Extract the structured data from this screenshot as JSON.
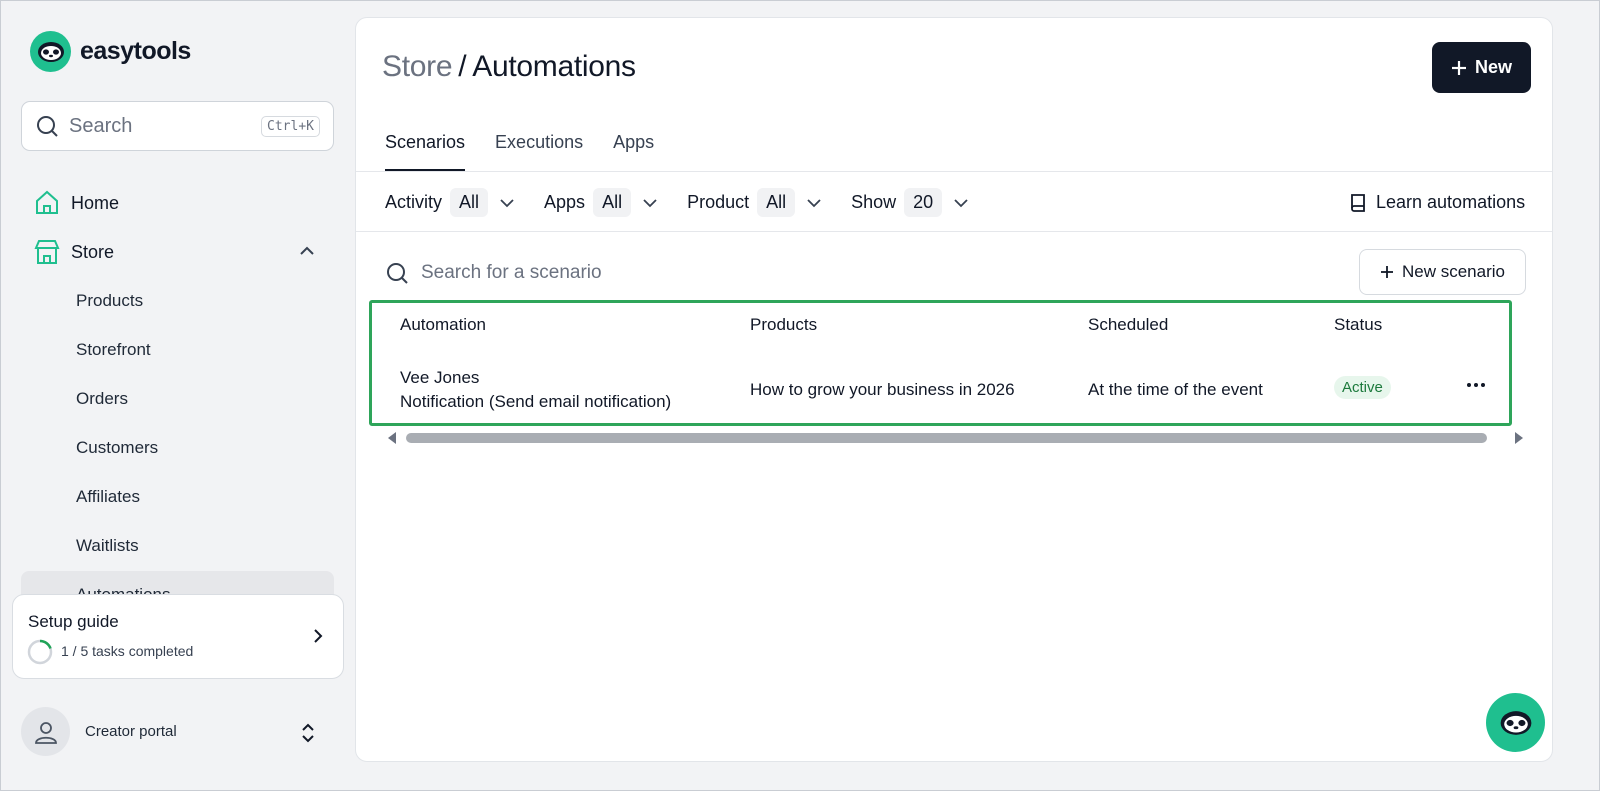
{
  "brand": {
    "name": "easytools",
    "accent": "#1fbf8f"
  },
  "sidebar": {
    "search": {
      "placeholder": "Search",
      "shortcut": "Ctrl+K"
    },
    "home_label": "Home",
    "store_label": "Store",
    "store_items": [
      "Products",
      "Storefront",
      "Orders",
      "Customers",
      "Affiliates",
      "Waitlists",
      "Automations"
    ],
    "setup_guide": {
      "title": "Setup guide",
      "progress_text": "1 / 5 tasks completed",
      "completed": 1,
      "total": 5
    },
    "portal_label": "Creator portal"
  },
  "header": {
    "breadcrumb_parent": "Store",
    "separator": "/",
    "title": "Automations",
    "new_button": "New"
  },
  "tabs": [
    {
      "label": "Scenarios",
      "active": true
    },
    {
      "label": "Executions",
      "active": false
    },
    {
      "label": "Apps",
      "active": false
    }
  ],
  "filters": [
    {
      "label": "Activity",
      "value": "All"
    },
    {
      "label": "Apps",
      "value": "All"
    },
    {
      "label": "Product",
      "value": "All"
    },
    {
      "label": "Show",
      "value": "20"
    }
  ],
  "learn_link": "Learn automations",
  "scenario_search": {
    "placeholder": "Search for a scenario"
  },
  "new_scenario_button": "New scenario",
  "table": {
    "columns": [
      "Automation",
      "Products",
      "Scheduled",
      "Status"
    ],
    "rows": [
      {
        "name": "Vee Jones",
        "description": "Notification (Send email notification)",
        "product": "How to grow your business in 2026",
        "scheduled": "At the time of the event",
        "status": "Active"
      }
    ]
  }
}
